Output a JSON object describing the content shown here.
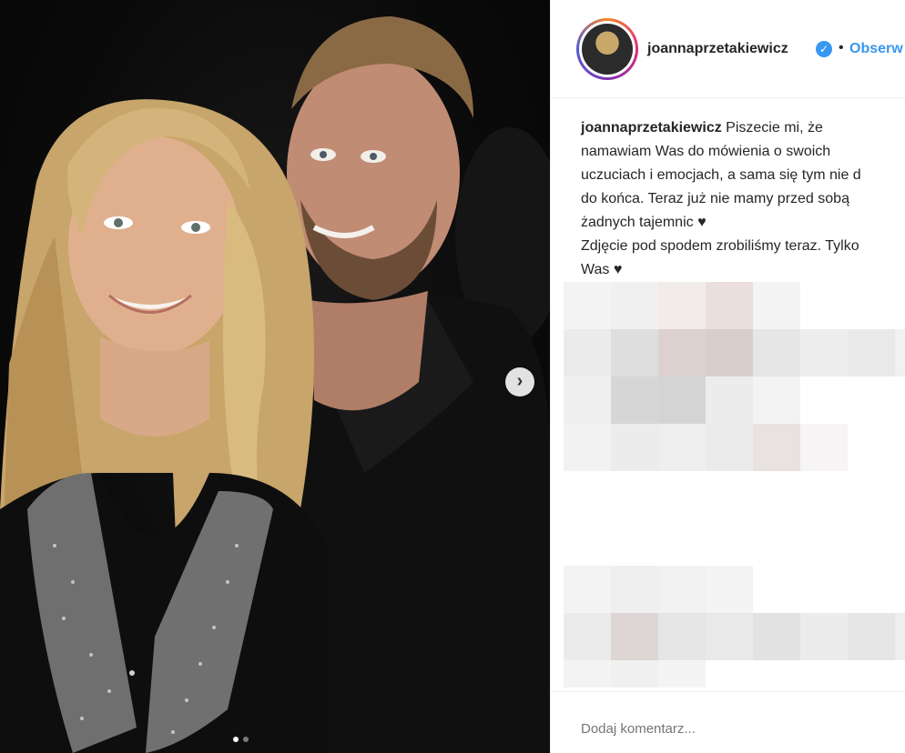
{
  "post": {
    "next_label": "›",
    "slide_count": 2,
    "active_slide": 1
  },
  "header": {
    "username": "joannaprzetakiewicz",
    "verified_mark": "✓",
    "separator": "•",
    "follow_label": "Obserw"
  },
  "caption": {
    "username": "joannaprzetakiewicz",
    "lines": [
      "Piszecie mi, że",
      "namawiam Was do mówienia o swoich",
      "uczuciach i emocjach, a sama się tym nie d",
      "do końca. Teraz już nie mamy przed sobą",
      "żadnych tajemnic ♥",
      "Zdjęcie pod spodem zrobiliśmy teraz. Tylko",
      "Was ♥"
    ]
  },
  "comment": {
    "placeholder": "Dodaj komentarz..."
  },
  "icons": {
    "next": "chevron-right-icon",
    "verified": "verified-badge-icon"
  },
  "colors": {
    "accent": "#3897f0",
    "text": "#262626",
    "muted": "#999999",
    "divider": "#efefef"
  }
}
